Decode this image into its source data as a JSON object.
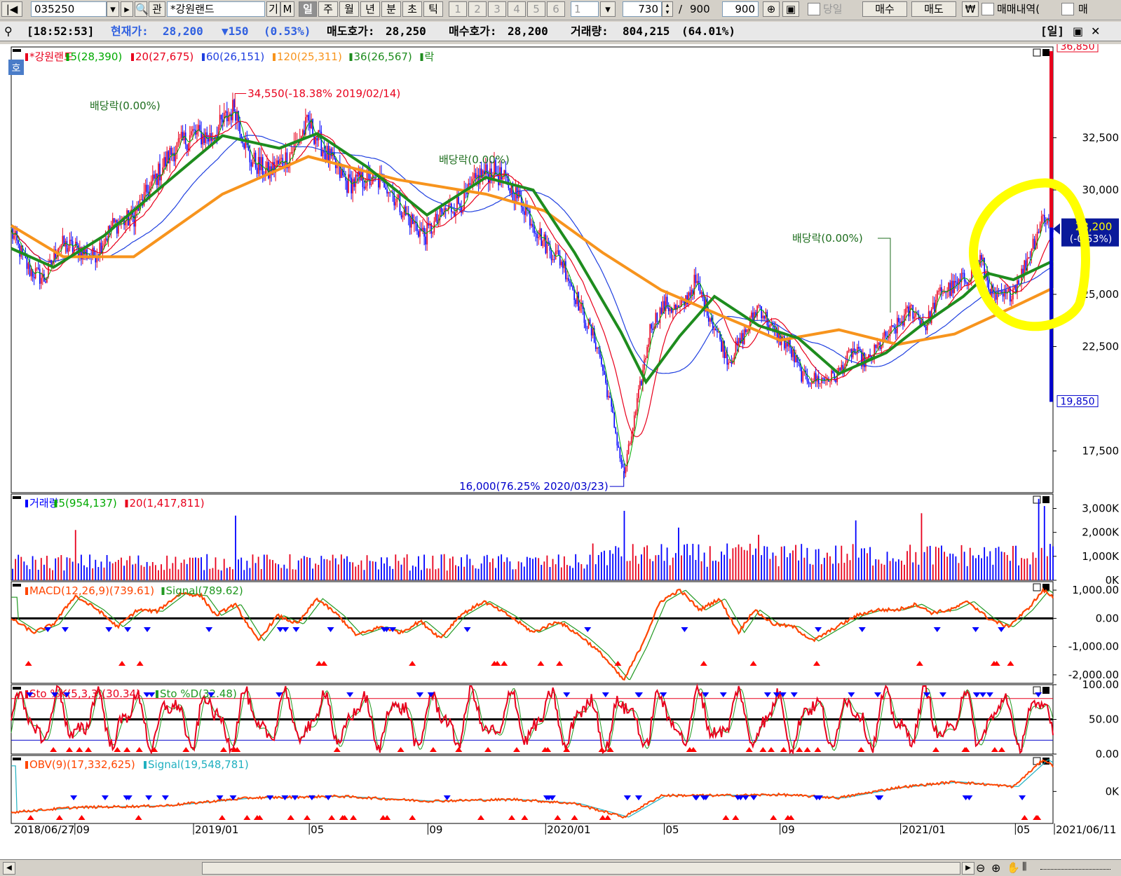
{
  "toolbar": {
    "code": "035250",
    "name": "*강원랜드",
    "btn_gi": "기",
    "btn_m": "M",
    "btn_gwan": "관",
    "periods": [
      "일",
      "주",
      "월",
      "년",
      "분",
      "초",
      "틱"
    ],
    "nums": [
      "1",
      "2",
      "3",
      "4",
      "5",
      "6"
    ],
    "interval": "1",
    "count": "730",
    "slash": "/",
    "total": "900",
    "total2": "900",
    "dangil": "당일",
    "buy": "매수",
    "sell": "매도",
    "won": "₩",
    "history": "매매내역(",
    "last": "매"
  },
  "info": {
    "time": "[18:52:53]",
    "price_label": "현재가:",
    "price": "28,200",
    "change": "▼150",
    "change_pct": "(0.53%)",
    "ask_label": "매도호가:",
    "ask": "28,250",
    "bid_label": "매수호가:",
    "bid": "28,200",
    "vol_label": "거래량:",
    "vol": "804,215",
    "vol_pct": "(64.01%)",
    "period_tag": "[일]"
  },
  "colors": {
    "candle_up": "#e8001c",
    "candle_down": "#0000ff",
    "ma5": "#00aa00",
    "ma20": "#e8001c",
    "ma60": "#2040e0",
    "ma120": "#f7941d",
    "ma36": "#1e8c1e",
    "highlight": "#ffff00",
    "macd": "#ff4500",
    "signal": "#229922",
    "obv_signal": "#20b0c0"
  },
  "chart_data": [
    {
      "type": "candlestick",
      "title": "*강원랜드",
      "legend": [
        {
          "name": "*강원랜드",
          "color": "#e8001c"
        },
        {
          "name": "5(28,390)",
          "color": "#00aa00"
        },
        {
          "name": "20(27,675)",
          "color": "#e8001c"
        },
        {
          "name": "60(26,151)",
          "color": "#2040e0"
        },
        {
          "name": "120(25,311)",
          "color": "#f7941d"
        },
        {
          "name": "36(26,567)",
          "color": "#1e8c1e"
        },
        {
          "name": "락",
          "color": "#1e8c1e"
        }
      ],
      "x_start": "2018/06/27",
      "x_end": "2021/06/11",
      "x_ticks": [
        "2018/06/27",
        "09",
        "2019/01",
        "05",
        "09",
        "2020/01",
        "05",
        "09",
        "2021/01",
        "05",
        "2021/06/11"
      ],
      "y_ticks": [
        "32,500",
        "30,000",
        "25,000",
        "22,500",
        "17,500"
      ],
      "ylim": [
        15500,
        36850
      ],
      "axis_max_label": "36,850",
      "axis_min_label": "19,850",
      "current": {
        "price": "28,200",
        "change": "(-0.53%)"
      },
      "annotations": {
        "high": "34,550(-18.38% 2019/02/14)",
        "low": "16,000(76.25% 2020/03/23)",
        "div1": "배당락(0.00%)",
        "div2": "배당락(0.00%)",
        "div3": "배당락(0.00%)"
      },
      "close_path": [
        [
          "2018-06-27",
          28000
        ],
        [
          "2018-07-15",
          26200
        ],
        [
          "2018-08-01",
          25700
        ],
        [
          "2018-08-15",
          27400
        ],
        [
          "2018-09-01",
          27200
        ],
        [
          "2018-09-20",
          26800
        ],
        [
          "2018-10-10",
          28300
        ],
        [
          "2018-11-01",
          28700
        ],
        [
          "2018-11-20",
          30300
        ],
        [
          "2018-12-10",
          31800
        ],
        [
          "2019-01-01",
          32700
        ],
        [
          "2019-01-20",
          32500
        ],
        [
          "2019-02-14",
          34000
        ],
        [
          "2019-03-01",
          31500
        ],
        [
          "2019-03-20",
          30800
        ],
        [
          "2019-04-10",
          31600
        ],
        [
          "2019-05-01",
          33200
        ],
        [
          "2019-05-20",
          31700
        ],
        [
          "2019-06-10",
          30300
        ],
        [
          "2019-07-01",
          30500
        ],
        [
          "2019-07-20",
          30400
        ],
        [
          "2019-08-10",
          28800
        ],
        [
          "2019-08-30",
          27800
        ],
        [
          "2019-09-20",
          29000
        ],
        [
          "2019-10-10",
          29500
        ],
        [
          "2019-10-25",
          30700
        ],
        [
          "2019-11-10",
          30900
        ],
        [
          "2019-11-25",
          30200
        ],
        [
          "2019-12-10",
          29300
        ],
        [
          "2019-12-31",
          27500
        ],
        [
          "2020-01-20",
          26500
        ],
        [
          "2020-02-10",
          24000
        ],
        [
          "2020-02-25",
          22500
        ],
        [
          "2020-03-10",
          19500
        ],
        [
          "2020-03-23",
          16300
        ],
        [
          "2020-04-05",
          19500
        ],
        [
          "2020-04-20",
          23500
        ],
        [
          "2020-05-05",
          24500
        ],
        [
          "2020-05-20",
          24200
        ],
        [
          "2020-06-05",
          25600
        ],
        [
          "2020-06-20",
          24000
        ],
        [
          "2020-07-10",
          21800
        ],
        [
          "2020-07-25",
          23000
        ],
        [
          "2020-08-10",
          24500
        ],
        [
          "2020-08-25",
          23200
        ],
        [
          "2020-09-10",
          22500
        ],
        [
          "2020-09-25",
          21000
        ],
        [
          "2020-10-15",
          20900
        ],
        [
          "2020-10-30",
          21100
        ],
        [
          "2020-11-15",
          22300
        ],
        [
          "2020-11-30",
          21700
        ],
        [
          "2020-12-15",
          22700
        ],
        [
          "2021-01-01",
          23500
        ],
        [
          "2021-01-15",
          24300
        ],
        [
          "2021-01-30",
          23500
        ],
        [
          "2021-02-15",
          25200
        ],
        [
          "2021-03-01",
          25300
        ],
        [
          "2021-03-15",
          25900
        ],
        [
          "2021-03-28",
          26700
        ],
        [
          "2021-04-10",
          24800
        ],
        [
          "2021-04-25",
          24900
        ],
        [
          "2021-05-10",
          26000
        ],
        [
          "2021-05-20",
          27300
        ],
        [
          "2021-06-01",
          28800
        ],
        [
          "2021-06-11",
          28200
        ]
      ],
      "ma120_path": [
        [
          "2018-06-27",
          28300
        ],
        [
          "2018-08-20",
          26800
        ],
        [
          "2018-11-01",
          26800
        ],
        [
          "2019-02-01",
          29800
        ],
        [
          "2019-05-01",
          31600
        ],
        [
          "2019-08-01",
          30500
        ],
        [
          "2019-11-01",
          29800
        ],
        [
          "2020-01-01",
          29000
        ],
        [
          "2020-03-01",
          27000
        ],
        [
          "2020-05-01",
          25200
        ],
        [
          "2020-07-01",
          24000
        ],
        [
          "2020-09-01",
          22800
        ],
        [
          "2020-11-01",
          23300
        ],
        [
          "2021-01-01",
          22600
        ],
        [
          "2021-03-01",
          23100
        ],
        [
          "2021-05-01",
          24400
        ],
        [
          "2021-06-11",
          25300
        ]
      ],
      "ma36_path": [
        [
          "2018-06-27",
          27200
        ],
        [
          "2018-08-10",
          26300
        ],
        [
          "2018-10-01",
          27800
        ],
        [
          "2018-12-01",
          30200
        ],
        [
          "2019-02-01",
          32600
        ],
        [
          "2019-04-01",
          32000
        ],
        [
          "2019-05-10",
          32700
        ],
        [
          "2019-07-01",
          31100
        ],
        [
          "2019-09-01",
          28800
        ],
        [
          "2019-11-01",
          30600
        ],
        [
          "2019-12-20",
          30000
        ],
        [
          "2020-02-01",
          27000
        ],
        [
          "2020-03-20",
          23200
        ],
        [
          "2020-04-15",
          20800
        ],
        [
          "2020-05-20",
          23000
        ],
        [
          "2020-06-25",
          24900
        ],
        [
          "2020-08-10",
          23500
        ],
        [
          "2020-09-20",
          22900
        ],
        [
          "2020-11-01",
          21200
        ],
        [
          "2020-12-20",
          22200
        ],
        [
          "2021-01-25",
          23500
        ],
        [
          "2021-03-10",
          24900
        ],
        [
          "2021-04-05",
          26000
        ],
        [
          "2021-05-01",
          25700
        ],
        [
          "2021-06-11",
          26600
        ]
      ]
    },
    {
      "type": "bar",
      "title": "거래량",
      "legend": [
        {
          "name": "거래량",
          "color": "#0000ff"
        },
        {
          "name": "5(954,137)",
          "color": "#00aa00"
        },
        {
          "name": "20(1,417,811)",
          "color": "#e8001c"
        }
      ],
      "y_ticks": [
        "3,000K",
        "2,000K",
        "1,000K",
        "0K"
      ],
      "ylim": [
        0,
        3600000
      ],
      "spikes": [
        [
          "2018-09-01",
          2100000
        ],
        [
          "2019-02-14",
          2700000
        ],
        [
          "2020-03-23",
          2900000
        ],
        [
          "2020-05-20",
          2200000
        ],
        [
          "2020-08-10",
          1900000
        ],
        [
          "2020-11-20",
          2500000
        ],
        [
          "2021-01-25",
          2800000
        ],
        [
          "2021-05-28",
          3400000
        ],
        [
          "2021-06-01",
          3100000
        ]
      ]
    },
    {
      "type": "line",
      "title": "MACD",
      "legend": [
        {
          "name": "MACD(12,26,9)(739.61)",
          "color": "#ff4500"
        },
        {
          "name": "Signal(789.62)",
          "color": "#229922"
        }
      ],
      "y_ticks": [
        "1,000.00",
        "0.00",
        "-1,000.00",
        "-2,000.00"
      ],
      "ylim": [
        -2300,
        1300
      ],
      "path": [
        [
          "2018-06-27",
          0
        ],
        [
          "2018-07-20",
          -500
        ],
        [
          "2018-08-10",
          -200
        ],
        [
          "2018-09-01",
          800
        ],
        [
          "2018-09-25",
          300
        ],
        [
          "2018-10-15",
          -300
        ],
        [
          "2018-11-05",
          300
        ],
        [
          "2018-11-25",
          250
        ],
        [
          "2018-12-20",
          900
        ],
        [
          "2019-01-10",
          800
        ],
        [
          "2019-01-25",
          100
        ],
        [
          "2019-02-14",
          500
        ],
        [
          "2019-03-10",
          -800
        ],
        [
          "2019-03-30",
          100
        ],
        [
          "2019-04-20",
          -200
        ],
        [
          "2019-05-10",
          700
        ],
        [
          "2019-06-01",
          100
        ],
        [
          "2019-06-20",
          -600
        ],
        [
          "2019-07-15",
          -300
        ],
        [
          "2019-08-05",
          -500
        ],
        [
          "2019-08-25",
          -100
        ],
        [
          "2019-09-15",
          -700
        ],
        [
          "2019-10-05",
          100
        ],
        [
          "2019-10-30",
          600
        ],
        [
          "2019-11-25",
          100
        ],
        [
          "2019-12-20",
          -500
        ],
        [
          "2020-01-15",
          -100
        ],
        [
          "2020-02-10",
          -700
        ],
        [
          "2020-03-01",
          -1300
        ],
        [
          "2020-03-23",
          -2200
        ],
        [
          "2020-04-10",
          -1000
        ],
        [
          "2020-04-30",
          600
        ],
        [
          "2020-05-20",
          1000
        ],
        [
          "2020-06-10",
          300
        ],
        [
          "2020-06-30",
          700
        ],
        [
          "2020-07-20",
          -500
        ],
        [
          "2020-08-05",
          300
        ],
        [
          "2020-08-25",
          -200
        ],
        [
          "2020-09-15",
          -300
        ],
        [
          "2020-10-05",
          -800
        ],
        [
          "2020-10-30",
          -300
        ],
        [
          "2020-11-20",
          100
        ],
        [
          "2020-12-10",
          300
        ],
        [
          "2021-01-01",
          300
        ],
        [
          "2021-01-20",
          500
        ],
        [
          "2021-02-05",
          200
        ],
        [
          "2021-02-25",
          300
        ],
        [
          "2021-03-15",
          600
        ],
        [
          "2021-04-05",
          0
        ],
        [
          "2021-04-25",
          -300
        ],
        [
          "2021-05-15",
          300
        ],
        [
          "2021-06-01",
          1000
        ],
        [
          "2021-06-11",
          750
        ]
      ]
    },
    {
      "type": "line",
      "title": "Stochastic",
      "legend": [
        {
          "name": "Sto %K(5,3,3)(30.34)",
          "color": "#e8001c"
        },
        {
          "name": "Sto %D(32.48)",
          "color": "#229922"
        }
      ],
      "y_ticks": [
        "100.00",
        "50.00",
        "0.00"
      ],
      "ylim": [
        0,
        100
      ],
      "hlines": [
        80,
        50,
        20
      ]
    },
    {
      "type": "line",
      "title": "OBV",
      "legend": [
        {
          "name": "OBV(9)(17,332,625)",
          "color": "#ff4500"
        },
        {
          "name": "Signal(19,548,781)",
          "color": "#20b0c0"
        }
      ],
      "y_ticks": [
        "0K"
      ],
      "ylim": [
        -40000000,
        45000000
      ],
      "path": [
        [
          "2018-06-27",
          -26000000
        ],
        [
          "2018-09-01",
          -20000000
        ],
        [
          "2018-12-01",
          -18000000
        ],
        [
          "2019-03-01",
          -8000000
        ],
        [
          "2019-06-01",
          -6000000
        ],
        [
          "2019-09-01",
          -12000000
        ],
        [
          "2019-12-01",
          -10000000
        ],
        [
          "2020-02-01",
          -15000000
        ],
        [
          "2020-03-23",
          -32000000
        ],
        [
          "2020-05-01",
          -5000000
        ],
        [
          "2020-07-01",
          -5000000
        ],
        [
          "2020-09-01",
          -4000000
        ],
        [
          "2020-11-01",
          -8000000
        ],
        [
          "2021-01-01",
          5000000
        ],
        [
          "2021-03-01",
          12000000
        ],
        [
          "2021-05-01",
          6000000
        ],
        [
          "2021-06-01",
          40000000
        ],
        [
          "2021-06-11",
          32000000
        ]
      ]
    }
  ]
}
